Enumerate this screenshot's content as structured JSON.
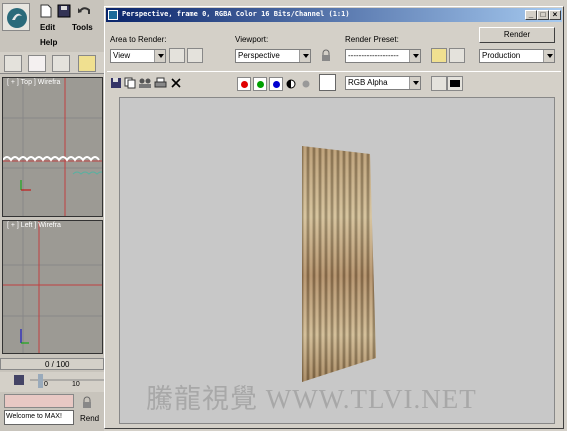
{
  "app": {
    "menu": {
      "edit": "Edit",
      "tools": "Tools",
      "help": "Help"
    },
    "viewports": [
      {
        "label": "[ + ] Top ] Wirefra"
      },
      {
        "label": "[ + ] Left ] Wirefra"
      }
    ],
    "time_slider": "0 / 100",
    "track_ticks": {
      "start": "0",
      "mid": "10"
    },
    "status": {
      "welcome": "Welcome to MAX!",
      "render_mini": "Rend"
    }
  },
  "render_window": {
    "title": "Perspective, frame 0, RGBA Color 16 Bits/Channel (1:1)",
    "controls": {
      "minimize": "_",
      "maximize": "□",
      "close": "×"
    },
    "area_to_render": {
      "label": "Area to Render:",
      "value": "View"
    },
    "viewport": {
      "label": "Viewport:",
      "value": "Perspective"
    },
    "render_preset": {
      "label": "Render Preset:",
      "value": "-------------------"
    },
    "render_button": "Render",
    "production": {
      "value": "Production"
    },
    "channel": {
      "value": "RGB Alpha"
    },
    "colors": {
      "red": "#e00000",
      "green": "#00a000",
      "blue": "#0000d0"
    },
    "watermark": "騰龍視覺 WWW.TLVI.NET"
  }
}
